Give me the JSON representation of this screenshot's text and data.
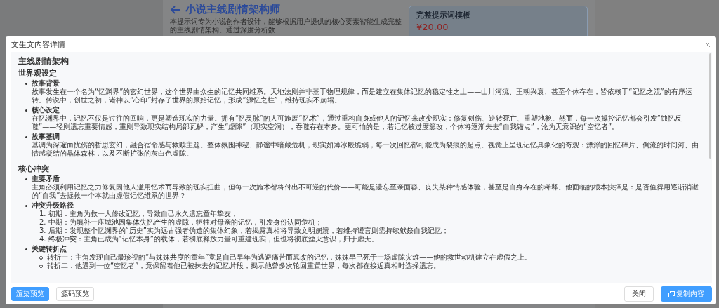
{
  "background": {
    "page_title": "小说主线剧情架构师",
    "description": "本提示词专为小说创作者设计，能够根据用户提供的核心要素智能生成完整的主线剧情架构。通过深度分析数",
    "card": {
      "title": "完整提示词模板",
      "price": "¥20.00"
    }
  },
  "dialog": {
    "title": "文生文内容详情",
    "content": {
      "title": "主线剧情架构",
      "sections": [
        {
          "heading": "世界观设定",
          "items": [
            {
              "kind": "text",
              "label": "故事背景",
              "text": "故事发生在一个名为“忆渊界”的玄幻世界，这个世界由众生的记忆共同维系。天地法则并非基于物理规律，而是建立在集体记忆的稳定性之上——山川河流、王朝兴衰、甚至个体存在，皆依赖于“记忆之流”的有序运转。传说中，创世之初，诸神以“心印”封存了世界的原始记忆，形成“源忆之柱”，维持现实不崩塌。"
            },
            {
              "kind": "text",
              "label": "核心设定",
              "text": "在忆渊界中，记忆不仅是过往的回响，更是塑造现实的力量。拥有“忆灵脉”的人可施展“忆术”，通过重构自身或他人的记忆来改变现实：修复创伤、逆转死亡、重塑地貌。然而，每一次操控记忆都会引发“蚀忆反噬”——轻则遗忘重要情感，重则导致现实结构局部瓦解，产生“虚隙”（现实空洞），吞噬存在本身。更可怕的是，若记忆被过度篡改，个体将逐渐失去“自我锚点”，沦为无意识的“空忆者”。"
            },
            {
              "kind": "text",
              "label": "故事基调",
              "text": "基调为深邃而忧伤的哲思玄幻，融合宿命感与救赎主题。整体氛围神秘、静谧中暗藏危机，现实如薄冰般脆弱，每一次回忆都可能成为裂痕的起点。视觉上呈现记忆具象化的奇观：漂浮的回忆碎片、倒流的时间河、由情感凝结的晶体森林，以及不断扩张的灰白色虚隙。"
            }
          ]
        },
        {
          "heading": "核心冲突",
          "items": [
            {
              "kind": "text",
              "label": "主要矛盾",
              "text": "主角必须利用记忆之力修复因他人滥用忆术而导致的现实扭曲，但每一次施术都将付出不可逆的代价——可能是遗忘至亲面容、丧失某种情感体验，甚至是自身存在的稀释。他面临的根本抉择是：是否值得用逐渐消逝的“自我”去拯救一个本就由虚假记忆维系的世界？"
            },
            {
              "kind": "steps",
              "label": "冲突升级路径",
              "steps": [
                {
                  "number": "1.",
                  "text": "初期：主角为救一人修改记忆，导致自己永久遗忘童年挚友；"
                },
                {
                  "number": "2.",
                  "text": "中期：为填补一座城池因集体失忆产生的虚隙，牺牲对母亲的记忆，引发身份认同危机；"
                },
                {
                  "number": "3.",
                  "text": "后期：发现整个忆渊界的“历史”实为远古强者伪造的集体幻象，若揭露真相将导致文明崩溃，若维持谎言则需持续献祭自我记忆；"
                },
                {
                  "number": "4.",
                  "text": "终极冲突：主角已成为“记忆本身”的载体，若彻底释放力量可重建现实，但也将彻底湮灭意识，归于虚无。"
                }
              ]
            },
            {
              "kind": "points",
              "label": "关键转折点",
              "points": [
                "转折一：主角发现自己最珍视的“与妹妹共度的童年”竟是自己早年为逃避痛苦而篡改的记忆，妹妹早已死于一场虚隙灾难——他的救世动机建立在虚假之上。",
                "转折二：他遇到一位“空忆者”，竟保留着他已被抹去的记忆片段，揭示他曾多次轮回重置世界，每次都在接近真相时选择遗忘。"
              ]
            }
          ]
        }
      ]
    },
    "view_tabs": [
      {
        "label": "渲染预览",
        "selected": true
      },
      {
        "label": "源码预览",
        "selected": false
      }
    ],
    "actions": [
      {
        "label": "关闭",
        "kind": "default"
      },
      {
        "label": "复制内容",
        "kind": "primary"
      }
    ]
  }
}
